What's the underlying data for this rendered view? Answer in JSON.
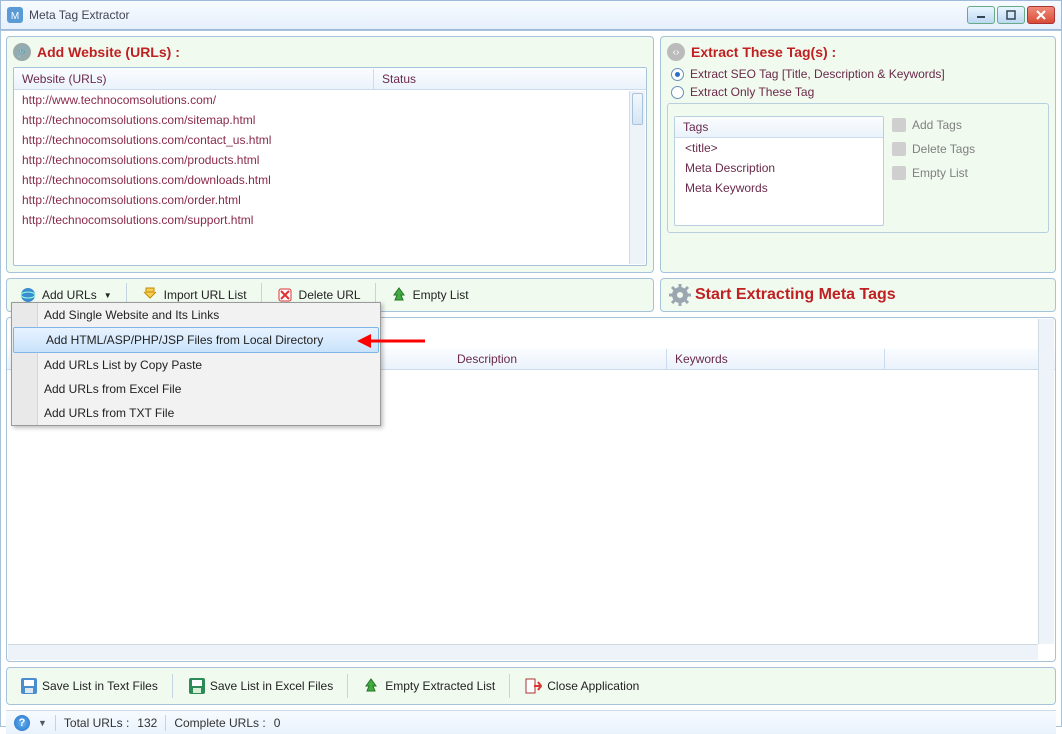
{
  "window": {
    "title": "Meta Tag Extractor"
  },
  "add_websites": {
    "heading": "Add Website (URLs) :",
    "col_url": "Website (URLs)",
    "col_status": "Status",
    "rows": [
      "http://www.technocomsolutions.com/",
      "http://technocomsolutions.com/sitemap.html",
      "http://technocomsolutions.com/contact_us.html",
      "http://technocomsolutions.com/products.html",
      "http://technocomsolutions.com/downloads.html",
      "http://technocomsolutions.com/order.html",
      "http://technocomsolutions.com/support.html"
    ]
  },
  "extract_panel": {
    "heading": "Extract These Tag(s) :",
    "opt_seo": "Extract SEO Tag [Title, Description & Keywords]",
    "opt_only": "Extract Only These Tag",
    "tags_header": "Tags",
    "tags": [
      "<title>",
      "Meta Description",
      "Meta Keywords"
    ],
    "btn_add": "Add Tags",
    "btn_delete": "Delete Tags",
    "btn_empty": "Empty List"
  },
  "toolbar": {
    "add_urls": "Add URLs",
    "import": "Import URL List",
    "delete": "Delete URL",
    "empty": "Empty List",
    "start": "Start Extracting Meta Tags"
  },
  "menu": {
    "items": [
      "Add Single Website and Its Links",
      "Add HTML/ASP/PHP/JSP Files from Local Directory",
      "Add URLs List by Copy Paste",
      "Add URLs from Excel File",
      "Add URLs from TXT File"
    ]
  },
  "results": {
    "col_desc": "Description",
    "col_kw": "Keywords"
  },
  "bottom": {
    "save_text": "Save List in Text Files",
    "save_excel": "Save List in Excel Files",
    "empty_extracted": "Empty Extracted List",
    "close": "Close Application"
  },
  "status": {
    "total_label": "Total URLs :",
    "total_val": "132",
    "complete_label": "Complete URLs :",
    "complete_val": "0"
  }
}
